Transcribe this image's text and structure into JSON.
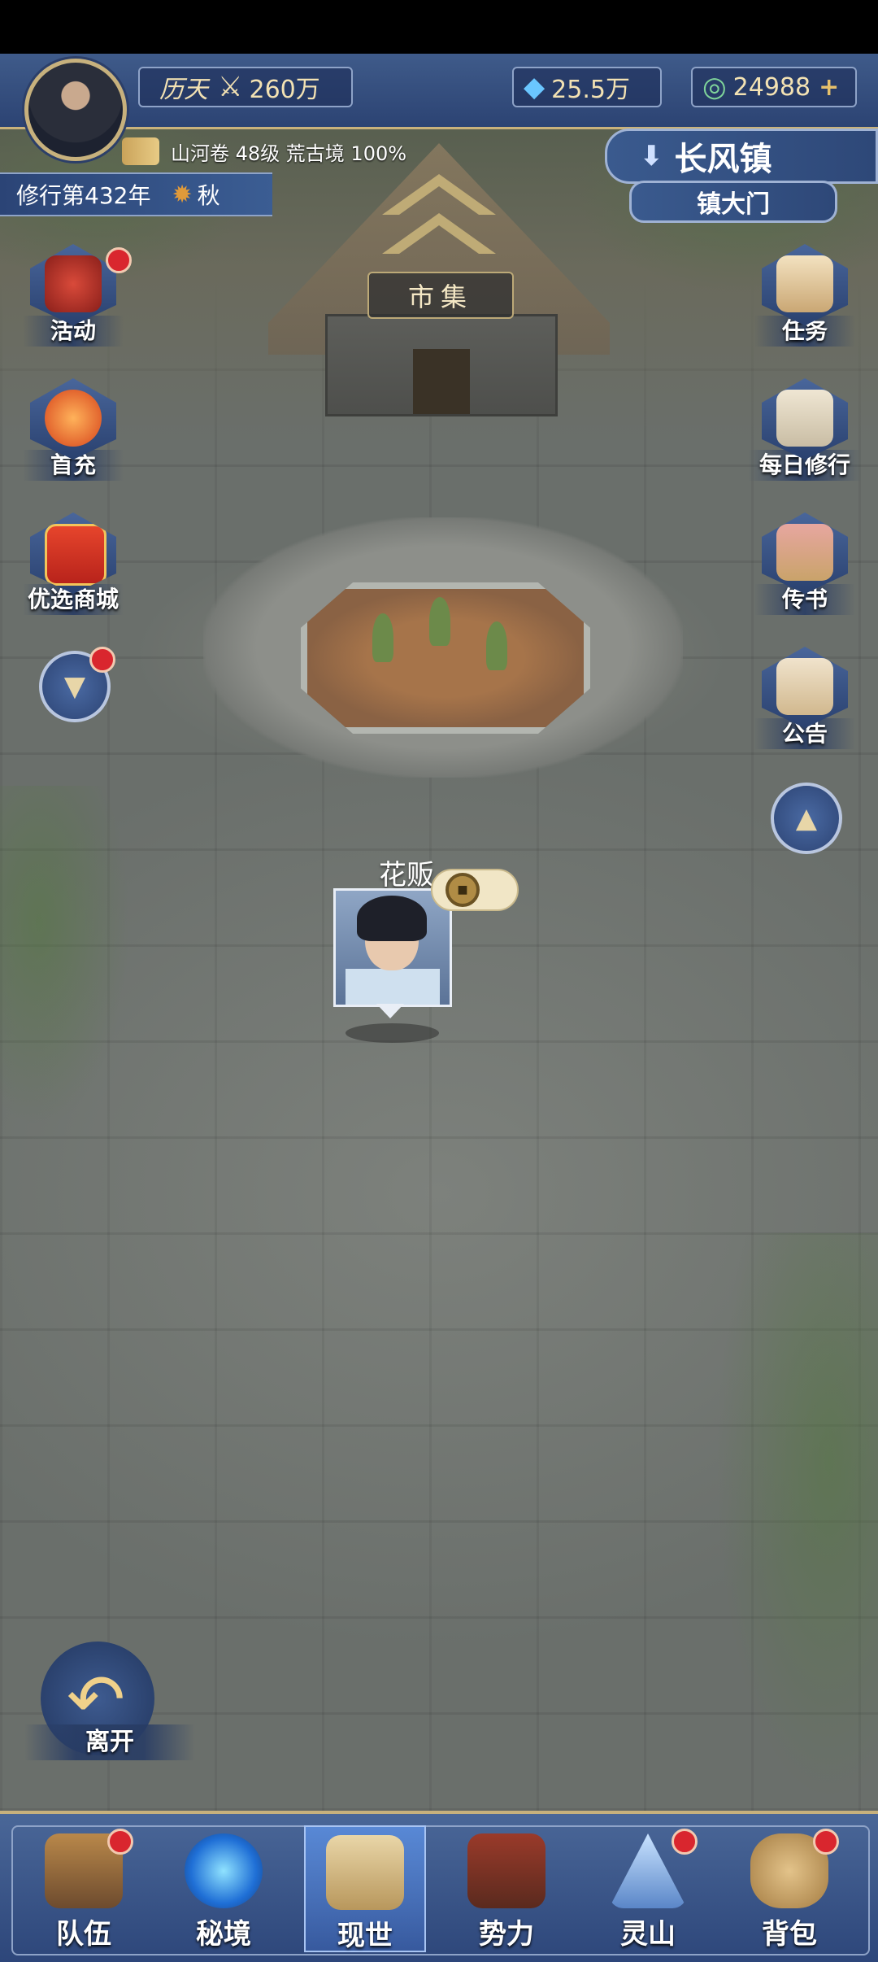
{
  "top": {
    "title_badge": "历天",
    "power_value": "260万",
    "crystal_value": "25.5万",
    "jade_value": "24988",
    "plus": "+"
  },
  "player": {
    "realm_line": "山河卷 48级 荒古境 100%",
    "cultivation_year": "修行第432年",
    "season": "秋"
  },
  "location": {
    "town": "长风镇",
    "spot": "镇大门"
  },
  "scene": {
    "market_label": "市集"
  },
  "left_buttons": [
    {
      "label": "活动",
      "icon": "event-drum-icon",
      "badge": true
    },
    {
      "label": "首充",
      "icon": "lantern-icon",
      "badge": false
    },
    {
      "label": "优选商城",
      "icon": "gift-box-icon",
      "badge": false
    }
  ],
  "right_buttons": [
    {
      "label": "任务",
      "icon": "quest-scroll-icon"
    },
    {
      "label": "每日修行",
      "icon": "book-icon"
    },
    {
      "label": "传书",
      "icon": "letter-icon"
    },
    {
      "label": "公告",
      "icon": "notice-icon"
    }
  ],
  "npc": {
    "name": "花贩"
  },
  "leave": {
    "label": "离开"
  },
  "bottom_nav": [
    {
      "label": "队伍",
      "icon": "team-hat-icon",
      "badge": true,
      "active": false
    },
    {
      "label": "秘境",
      "icon": "portal-icon",
      "badge": false,
      "active": false
    },
    {
      "label": "现世",
      "icon": "world-map-icon",
      "badge": false,
      "active": true
    },
    {
      "label": "势力",
      "icon": "palace-icon",
      "badge": false,
      "active": false
    },
    {
      "label": "灵山",
      "icon": "mountain-icon",
      "badge": true,
      "active": false
    },
    {
      "label": "背包",
      "icon": "bag-icon",
      "badge": true,
      "active": false
    }
  ],
  "colors": {
    "hud_blue": "#2c4373",
    "gold": "#c7b17d",
    "badge_red": "#d9262e"
  }
}
